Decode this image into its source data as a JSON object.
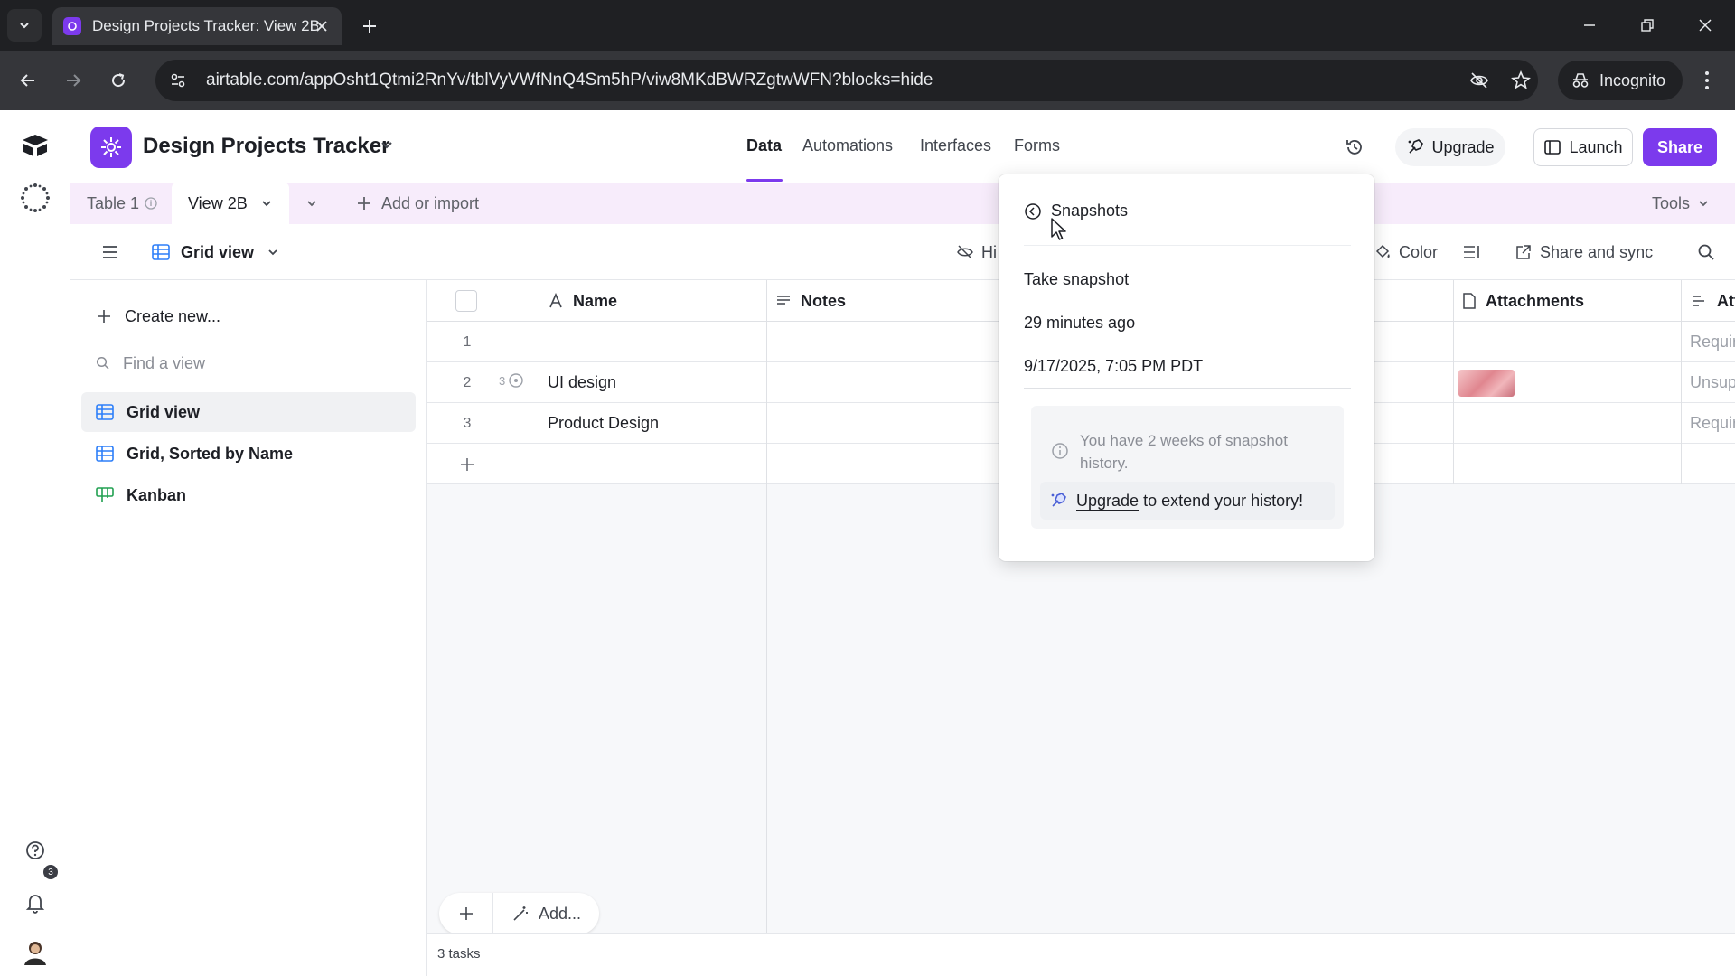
{
  "browser": {
    "tab_title": "Design Projects Tracker: View 2B",
    "url": "airtable.com/appOsht1Qtmi2RnYv/tblVyVWfNnQ4Sm5hP/viw8MKdBWRZgtwWFN?blocks=hide",
    "incognito_label": "Incognito"
  },
  "app": {
    "base_title": "Design Projects Tracker",
    "nav_tabs": [
      "Data",
      "Automations",
      "Interfaces",
      "Forms"
    ],
    "upgrade_label": "Upgrade",
    "launch_label": "Launch",
    "share_label": "Share",
    "notification_count": "3"
  },
  "tablebar": {
    "table_tab": "Table 1",
    "view_tab": "View 2B",
    "add_import": "Add or import",
    "tools": "Tools"
  },
  "viewbar": {
    "view_name": "Grid view",
    "hide_label": "Hi",
    "color_label": "Color",
    "share_sync_label": "Share and sync"
  },
  "sidebar": {
    "create_new": "Create new...",
    "find_placeholder": "Find a view",
    "views": [
      {
        "label": "Grid view",
        "type": "grid"
      },
      {
        "label": "Grid, Sorted by Name",
        "type": "grid"
      },
      {
        "label": "Kanban",
        "type": "kanban"
      }
    ]
  },
  "grid": {
    "columns": [
      "Name",
      "Notes",
      "Attachments",
      "Att"
    ],
    "rows": [
      {
        "num": "1",
        "name": "",
        "attachment_status": "Requir",
        "comments": ""
      },
      {
        "num": "2",
        "name": "UI design",
        "attachment_status": "Unsup",
        "comments": "3"
      },
      {
        "num": "3",
        "name": "Product Design",
        "attachment_status": "Requir",
        "comments": ""
      }
    ],
    "add_label": "Add...",
    "record_count": "3 tasks"
  },
  "snapshots": {
    "title": "Snapshots",
    "take_snapshot": "Take snapshot",
    "relative_time": "29 minutes ago",
    "timestamp": "9/17/2025, 7:05 PM PDT",
    "info_text": "You have 2 weeks of snapshot history.",
    "upgrade_link": "Upgrade",
    "upgrade_rest": "to extend your history!"
  },
  "colors": {
    "accent": "#7c3aed",
    "tablebar_bg": "#f7ecfb",
    "chrome_dark": "#202124"
  }
}
